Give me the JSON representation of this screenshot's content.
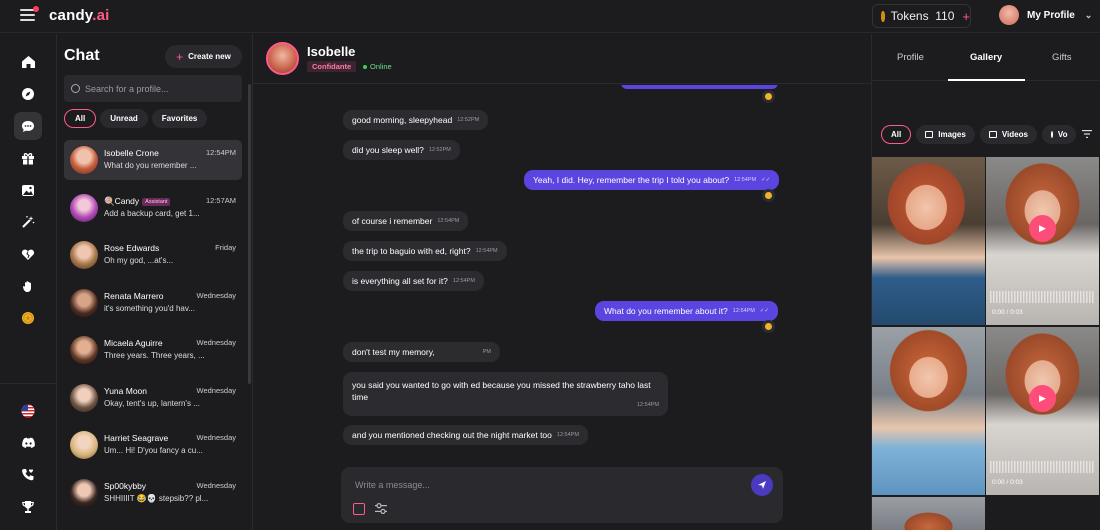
{
  "app": {
    "logo_main": "candy",
    "logo_tld": ".ai",
    "tokens_label": "Tokens",
    "tokens_value": "110",
    "profile_label": "My Profile"
  },
  "rail": {
    "icons": [
      "home-icon",
      "compass-icon",
      "chat-icon",
      "gift-box-icon",
      "gallery-icon",
      "magic-wand-icon",
      "heart-broken-icon",
      "hand-icon",
      "coin-icon"
    ],
    "bottom_icons": [
      "us-flag-icon",
      "discord-icon",
      "phone-heart-icon",
      "trophy-icon"
    ]
  },
  "chatlist": {
    "title": "Chat",
    "create_label": "Create new",
    "search_placeholder": "Search for a profile...",
    "filters": [
      "All",
      "Unread",
      "Favorites"
    ],
    "items": [
      {
        "name": "Isobelle Crone",
        "time": "12:54PM",
        "preview": "What do you remember ..."
      },
      {
        "name": "🍭Candy",
        "badge": "Assistant",
        "time": "12:57AM",
        "preview": "Add a backup card, get 1..."
      },
      {
        "name": "Rose Edwards",
        "time": "Friday",
        "preview": "Oh my god, ...at's..."
      },
      {
        "name": "Renata Marrero",
        "time": "Wednesday",
        "preview": "it's something you'd hav..."
      },
      {
        "name": "Micaela Aguirre",
        "time": "Wednesday",
        "preview": "Three years. Three years, ..."
      },
      {
        "name": "Yuna Moon",
        "time": "Wednesday",
        "preview": "Okay, tent's up, lantern's ..."
      },
      {
        "name": "Harriet Seagrave",
        "time": "Wednesday",
        "preview": "Um... Hi! D'you fancy a cu..."
      },
      {
        "name": "Sp00kybby",
        "time": "Wednesday",
        "preview": "SHHIIIIT 😂💀 stepsib?? pl..."
      }
    ]
  },
  "chat": {
    "name": "Isobelle",
    "role": "Confidante",
    "status": "Online",
    "messages": [
      {
        "text": "good morning, sleepyhead",
        "time": "12:52PM"
      },
      {
        "text": "did you sleep well?",
        "time": "12:52PM"
      },
      {
        "text": "Yeah, I did. Hey, remember the trip I told you about?",
        "time": "12:54PM"
      },
      {
        "text": "of course i remember",
        "time": "12:54PM"
      },
      {
        "text": "the trip to baguio with ed, right?",
        "time": "12:54PM"
      },
      {
        "text": "is everything all set for it?",
        "time": "12:54PM"
      },
      {
        "text": "What do you remember about it?",
        "time": "12:54PM"
      },
      {
        "text": "don't test my memory,",
        "time": "PM"
      },
      {
        "text": "you said you wanted to go with ed because you missed the strawberry taho last",
        "text2": "time",
        "time": "12:54PM"
      },
      {
        "text": "and you mentioned checking out the night market too",
        "time": "12:54PM"
      }
    ],
    "composer_placeholder": "Write a message..."
  },
  "gallery": {
    "tabs": [
      "Profile",
      "Gallery",
      "Gifts"
    ],
    "filters": [
      "All",
      "Images",
      "Videos",
      "Vo"
    ],
    "durations": [
      "0:00 / 0:03",
      "0:00 / 0:03"
    ]
  }
}
